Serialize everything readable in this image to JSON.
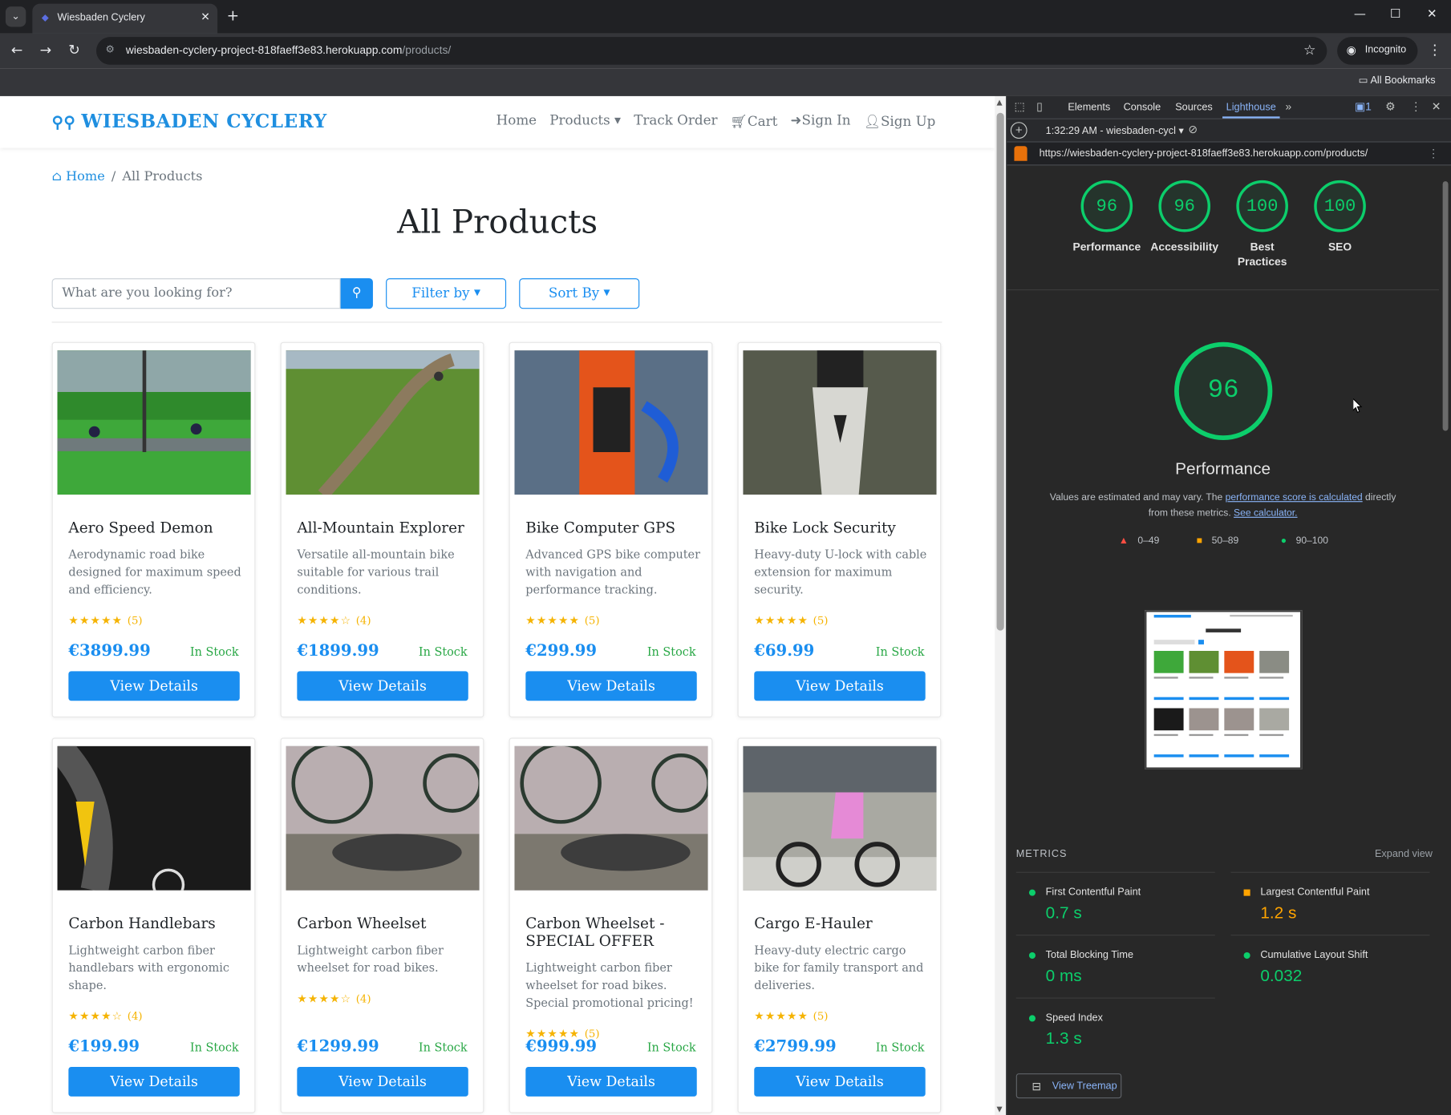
{
  "browser": {
    "tab_title": "Wiesbaden Cyclery",
    "url_host": "wiesbaden-cyclery-project-818faeff3e83.herokuapp.com",
    "url_path": "/products/",
    "incognito_label": "Incognito",
    "bookmarks_label": "All Bookmarks"
  },
  "site": {
    "brand": "WIESBADEN CYCLERY",
    "nav": {
      "home": "Home",
      "products": "Products",
      "track": "Track Order",
      "cart": "Cart",
      "signin": "Sign In",
      "signup": "Sign Up"
    },
    "breadcrumb": {
      "home": "Home",
      "current": "All Products"
    },
    "heading": "All Products",
    "search_placeholder": "What are you looking for?",
    "filter_label": "Filter by",
    "sort_label": "Sort By",
    "view_label": "View Details"
  },
  "products": [
    {
      "name": "Aero Speed Demon",
      "desc": "Aerodynamic road bike designed for maximum speed and efficiency.",
      "stars": "★★★★★",
      "count": "(5)",
      "price": "€3899.99",
      "stock": "In Stock"
    },
    {
      "name": "All-Mountain Explorer",
      "desc": "Versatile all-mountain bike suitable for various trail conditions.",
      "stars": "★★★★☆",
      "count": "(4)",
      "price": "€1899.99",
      "stock": "In Stock"
    },
    {
      "name": "Bike Computer GPS",
      "desc": "Advanced GPS bike computer with navigation and performance tracking.",
      "stars": "★★★★★",
      "count": "(5)",
      "price": "€299.99",
      "stock": "In Stock"
    },
    {
      "name": "Bike Lock Security",
      "desc": "Heavy-duty U-lock with cable extension for maximum security.",
      "stars": "★★★★★",
      "count": "(5)",
      "price": "€69.99",
      "stock": "In Stock"
    },
    {
      "name": "Carbon Handlebars",
      "desc": "Lightweight carbon fiber handlebars with ergonomic shape.",
      "stars": "★★★★☆",
      "count": "(4)",
      "price": "€199.99",
      "stock": "In Stock"
    },
    {
      "name": "Carbon Wheelset",
      "desc": "Lightweight carbon fiber wheelset for road bikes.",
      "stars": "★★★★☆",
      "count": "(4)",
      "price": "€1299.99",
      "stock": "In Stock"
    },
    {
      "name": "Carbon Wheelset - SPECIAL OFFER",
      "desc": "Lightweight carbon fiber wheelset for road bikes. Special promotional pricing!",
      "stars": "★★★★★",
      "count": "(5)",
      "price": "€999.99",
      "stock": "In Stock"
    },
    {
      "name": "Cargo E-Hauler",
      "desc": "Heavy-duty electric cargo bike for family transport and deliveries.",
      "stars": "★★★★★",
      "count": "(5)",
      "price": "€2799.99",
      "stock": "In Stock"
    }
  ],
  "devtools": {
    "tabs": {
      "elements": "Elements",
      "console": "Console",
      "sources": "Sources",
      "lighthouse": "Lighthouse"
    },
    "issues_count": "1",
    "report_label": "1:32:29 AM - wiesbaden-cycl",
    "report_url": "https://wiesbaden-cyclery-project-818faeff3e83.herokuapp.com/products/",
    "scores": [
      {
        "value": "96",
        "label": "Performance"
      },
      {
        "value": "96",
        "label": "Accessibility"
      },
      {
        "value": "100",
        "label": "Best Practices"
      },
      {
        "value": "100",
        "label": "SEO"
      }
    ],
    "main_score": "96",
    "main_label": "Performance",
    "note_pre": "Values are estimated and may vary. The ",
    "note_link1": "performance score is calculated",
    "note_mid": " directly from these metrics. ",
    "note_link2": "See calculator.",
    "legend": {
      "low": "0–49",
      "mid": "50–89",
      "high": "90–100"
    },
    "metrics_title": "METRICS",
    "expand_label": "Expand view",
    "metrics": [
      {
        "name": "First Contentful Paint",
        "value": "0.7 s",
        "status": "good"
      },
      {
        "name": "Largest Contentful Paint",
        "value": "1.2 s",
        "status": "average"
      },
      {
        "name": "Total Blocking Time",
        "value": "0 ms",
        "status": "good"
      },
      {
        "name": "Cumulative Layout Shift",
        "value": "0.032",
        "status": "good"
      },
      {
        "name": "Speed Index",
        "value": "1.3 s",
        "status": "good"
      }
    ],
    "treemap_label": "View Treemap"
  },
  "colors": {
    "accent": "#1a8ef0",
    "good": "#0cce6b",
    "average": "#ffa400",
    "poor": "#ff4e42"
  }
}
